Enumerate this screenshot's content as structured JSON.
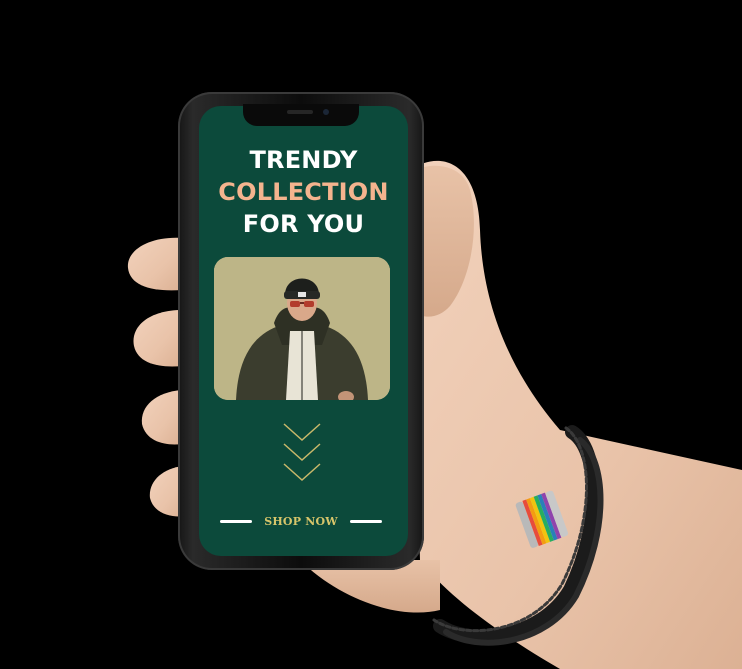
{
  "promo": {
    "headline_line1": "TRENDY",
    "headline_line2": "COLLECTION",
    "headline_line3": "FOR YOU",
    "cta_label": "SHOP NOW"
  },
  "colors": {
    "background": "#000000",
    "screen_green": "#0c4a3b",
    "accent_peach": "#f4b48e",
    "cta_gold": "#d7c56a",
    "headline_white": "#ffffff"
  },
  "icons": {
    "scroll_indicator": "triple-chevron-down-icon",
    "wristband": "rainbow-clasp-bracelet"
  }
}
